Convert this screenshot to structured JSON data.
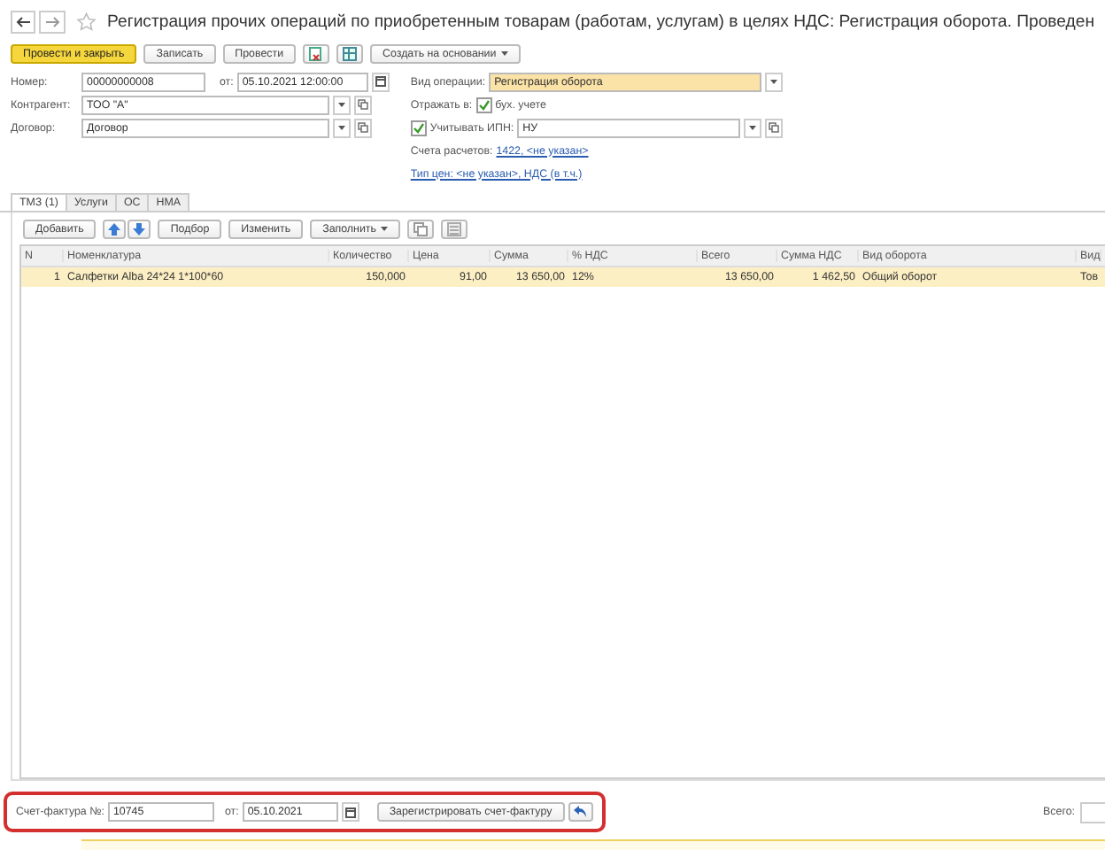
{
  "title": "Регистрация прочих операций по приобретенным товарам (работам, услугам) в целях НДС: Регистрация оборота. Проведен",
  "toolbar": {
    "primary": "Провести и закрыть",
    "buttons": [
      "Записать",
      "Провести"
    ],
    "create": "Создать на основании"
  },
  "form": {
    "number_label": "Номер:",
    "number": "00000000008",
    "date_label": "от:",
    "date": "05.10.2021 12:00:00",
    "counterparty_label": "Контрагент:",
    "counterparty": "ТОО \"А\"",
    "contract_label": "Договор:",
    "contract": "Договор",
    "operation_label": "Вид операции:",
    "operation": "Регистрация оборота",
    "reflect_label": "Отражать в:",
    "reflect": {
      "label": "бух. учете",
      "checked": true
    },
    "ipn": {
      "label": "Учитывать ИПН:",
      "checked": true
    },
    "ipn_value": "НУ",
    "accounts_label": "Счета расчетов:",
    "accounts_link": "1422, <не указан>",
    "price_link": "Тип цен: <не указан>, НДС (в т.ч.)"
  },
  "tabs": [
    {
      "label": "ТМЗ (1)",
      "selected": true
    },
    {
      "label": "Услуги",
      "selected": false
    },
    {
      "label": "ОС",
      "selected": false
    },
    {
      "label": "НМА",
      "selected": false
    }
  ],
  "table_toolbar": {
    "add": "Добавить",
    "pick": "Подбор",
    "edit": "Изменить",
    "fill": "Заполнить"
  },
  "table": {
    "columns": [
      "N",
      "Номенклатура",
      "Количество",
      "Цена",
      "Сумма",
      "% НДС",
      "Всего",
      "Сумма НДС",
      "Вид оборота",
      "Вид"
    ],
    "rows": [
      {
        "selected": true,
        "cells": [
          "1",
          "Салфетки Alba 24*24 1*100*60",
          "150,000",
          "91,00",
          "13 650,00",
          "12%",
          "13 650,00",
          "1 462,50",
          "Общий оборот",
          "Тов"
        ]
      }
    ]
  },
  "invoice": {
    "label": "Счет-фактура №:",
    "number": "10745",
    "date_label": "от:",
    "date": "05.10.2021",
    "register": "Зарегистрировать счет-фактуру"
  },
  "total_label": "Всего:"
}
